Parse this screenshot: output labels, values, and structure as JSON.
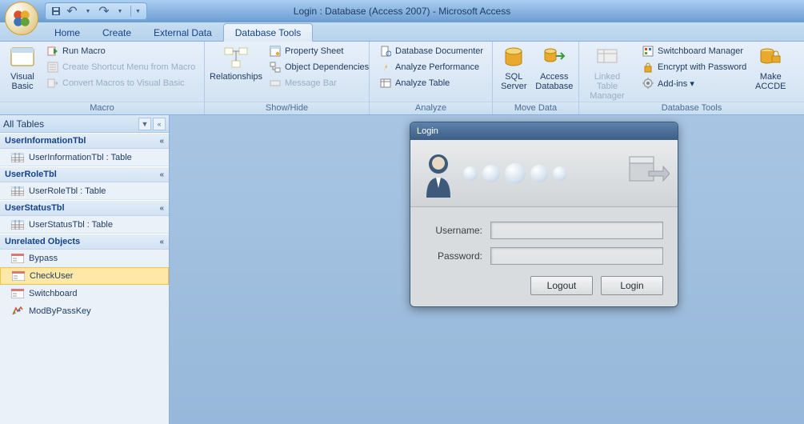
{
  "title": "Login : Database (Access 2007) - Microsoft Access",
  "tabs": [
    "Home",
    "Create",
    "External Data",
    "Database Tools"
  ],
  "active_tab": 3,
  "ribbon": {
    "groups": [
      {
        "label": "Macro",
        "big": [
          {
            "label": "Visual Basic"
          }
        ],
        "items": [
          {
            "label": "Run Macro",
            "disabled": false
          },
          {
            "label": "Create Shortcut Menu from Macro",
            "disabled": true
          },
          {
            "label": "Convert Macros to Visual Basic",
            "disabled": true
          }
        ]
      },
      {
        "label": "Show/Hide",
        "big": [
          {
            "label": "Relationships"
          }
        ],
        "items": [
          {
            "label": "Property Sheet",
            "disabled": false
          },
          {
            "label": "Object Dependencies",
            "disabled": false
          },
          {
            "label": "Message Bar",
            "disabled": true
          }
        ]
      },
      {
        "label": "Analyze",
        "big": [],
        "items": [
          {
            "label": "Database Documenter",
            "disabled": false
          },
          {
            "label": "Analyze Performance",
            "disabled": false
          },
          {
            "label": "Analyze Table",
            "disabled": false
          }
        ]
      },
      {
        "label": "Move Data",
        "big": [
          {
            "label": "SQL Server"
          },
          {
            "label": "Access Database"
          }
        ],
        "items": []
      },
      {
        "label": "",
        "big": [
          {
            "label": "Linked Table Manager",
            "disabled": true
          }
        ],
        "items": []
      },
      {
        "label": "Database Tools",
        "big": [
          {
            "label": "Make ACCDE"
          }
        ],
        "items": [
          {
            "label": "Switchboard Manager",
            "disabled": false
          },
          {
            "label": "Encrypt with Password",
            "disabled": false
          },
          {
            "label": "Add-ins ▾",
            "disabled": false
          }
        ]
      }
    ]
  },
  "nav": {
    "header": "All Tables",
    "groups": [
      {
        "title": "UserInformationTbl",
        "items": [
          {
            "label": "UserInformationTbl : Table",
            "icon": "table"
          }
        ]
      },
      {
        "title": "UserRoleTbl",
        "items": [
          {
            "label": "UserRoleTbl : Table",
            "icon": "table"
          }
        ]
      },
      {
        "title": "UserStatusTbl",
        "items": [
          {
            "label": "UserStatusTbl : Table",
            "icon": "table"
          }
        ]
      },
      {
        "title": "Unrelated Objects",
        "items": [
          {
            "label": "Bypass",
            "icon": "form"
          },
          {
            "label": "CheckUser",
            "icon": "form",
            "selected": true
          },
          {
            "label": "Switchboard",
            "icon": "form"
          },
          {
            "label": "ModByPassKey",
            "icon": "module"
          }
        ]
      }
    ]
  },
  "dialog": {
    "title": "Login",
    "username_label": "Username:",
    "password_label": "Password:",
    "username_value": "",
    "password_value": "",
    "logout_label": "Logout",
    "login_label": "Login"
  }
}
